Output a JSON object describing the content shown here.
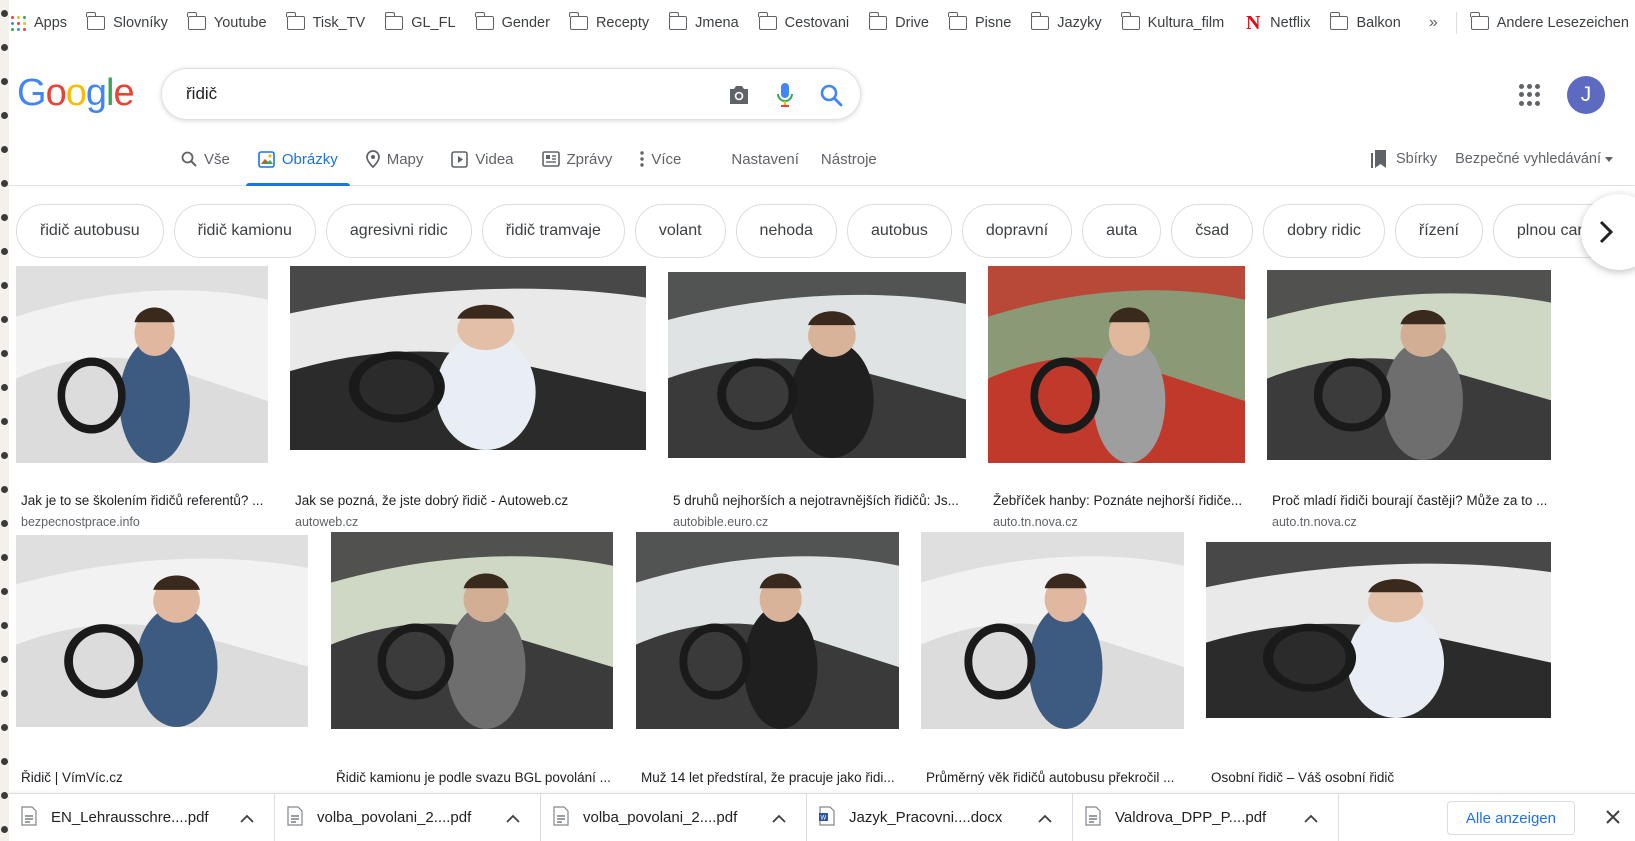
{
  "bookmarks": {
    "apps_label": "Apps",
    "items": [
      {
        "label": "Slovníky",
        "icon": "folder-icon"
      },
      {
        "label": "Youtube",
        "icon": "folder-icon"
      },
      {
        "label": "Tisk_TV",
        "icon": "folder-icon"
      },
      {
        "label": "GL_FL",
        "icon": "folder-icon"
      },
      {
        "label": "Gender",
        "icon": "folder-icon"
      },
      {
        "label": "Recepty",
        "icon": "folder-icon"
      },
      {
        "label": "Jmena",
        "icon": "folder-icon"
      },
      {
        "label": "Cestovani",
        "icon": "folder-icon"
      },
      {
        "label": "Drive",
        "icon": "folder-icon"
      },
      {
        "label": "Pisne",
        "icon": "folder-icon"
      },
      {
        "label": "Jazyky",
        "icon": "folder-icon"
      },
      {
        "label": "Kultura_film",
        "icon": "folder-icon"
      },
      {
        "label": "Netflix",
        "icon": "netflix-icon"
      },
      {
        "label": "Balkon",
        "icon": "folder-icon"
      }
    ],
    "more": "»",
    "other_label": "Andere Lesezeichen"
  },
  "header": {
    "logo": [
      "G",
      "o",
      "o",
      "g",
      "l",
      "e"
    ],
    "logo_colors": [
      "#4285f4",
      "#ea4335",
      "#fbbc05",
      "#4285f4",
      "#34a853",
      "#ea4335"
    ],
    "search_value": "řidič",
    "avatar_letter": "J",
    "avatar_color": "#5c6bc0"
  },
  "tabs": {
    "items": [
      {
        "label": "Vše",
        "icon": "search-icon",
        "active": false
      },
      {
        "label": "Obrázky",
        "icon": "image-icon",
        "active": true
      },
      {
        "label": "Mapy",
        "icon": "map-pin-icon",
        "active": false
      },
      {
        "label": "Videa",
        "icon": "play-icon",
        "active": false
      },
      {
        "label": "Zprávy",
        "icon": "news-icon",
        "active": false
      },
      {
        "label": "Více",
        "icon": "more-vert-icon",
        "active": false
      }
    ],
    "settings": "Nastavení",
    "tools": "Nástroje",
    "collections": "Sbírky",
    "safe_search": "Bezpečné vyhledávání"
  },
  "chips": [
    "řidič autobusu",
    "řidič kamionu",
    "agresivni ridic",
    "řidič tramvaje",
    "volant",
    "nehoda",
    "autobus",
    "dopravní",
    "auta",
    "čsad",
    "dobry ridic",
    "řízení",
    "plnou caru"
  ],
  "results": {
    "row1": [
      {
        "caption": "Jak je to se školením řidičů referentů? ...",
        "source": "bezpecnostprace.info"
      },
      {
        "caption": "Jak se pozná, že jste dobrý řidič - Autoweb.cz",
        "source": "autoweb.cz"
      },
      {
        "caption": "5 druhů nejhorších a nejotravnějších řidičů: Js...",
        "source": "autobible.euro.cz"
      },
      {
        "caption": "Žebříček hanby: Poznáte nejhorší řidiče...",
        "source": "auto.tn.nova.cz"
      },
      {
        "caption": "Proč mladí řidiči bourají častěji? Může za to ...",
        "source": "auto.tn.nova.cz"
      }
    ],
    "row2": [
      {
        "caption": "Řidič | VímVíc.cz"
      },
      {
        "caption": "Řidič kamionu je podle svazu BGL povolání ..."
      },
      {
        "caption": "Muž 14 let předstíral, že pracuje jako řidi..."
      },
      {
        "caption": "Průměrný věk řidičů autobusu překročil ..."
      },
      {
        "caption": "Osobní řidič – Váš osobní řidič"
      }
    ]
  },
  "downloads": {
    "files": [
      {
        "name": "EN_Lehrausschre....pdf",
        "type": "pdf"
      },
      {
        "name": "volba_povolani_2....pdf",
        "type": "pdf"
      },
      {
        "name": "volba_povolani_2....pdf",
        "type": "pdf"
      },
      {
        "name": "Jazyk_Pracovni....docx",
        "type": "docx"
      },
      {
        "name": "Valdrova_DPP_P....pdf",
        "type": "pdf"
      }
    ],
    "show_all": "Alle anzeigen"
  },
  "colors": {
    "accent": "#1a73e8",
    "netflix": "#e50914"
  }
}
